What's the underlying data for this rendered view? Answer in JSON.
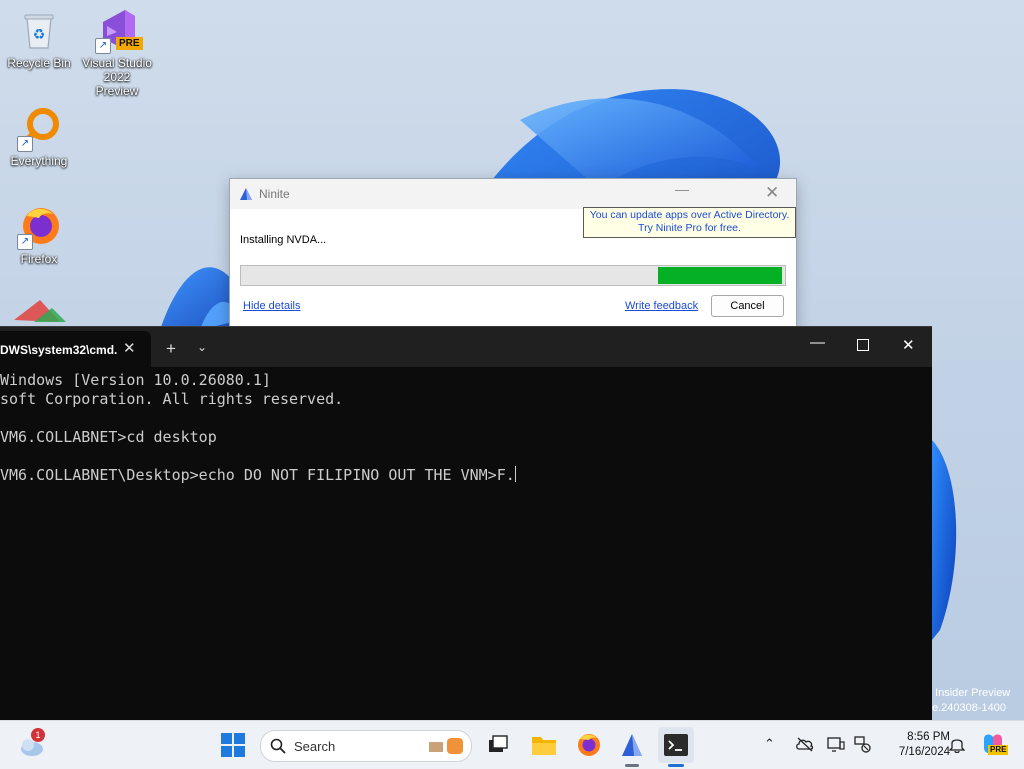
{
  "desktop": {
    "icons": [
      {
        "label": "Recycle Bin"
      },
      {
        "label": "Visual Studio\n2022 Preview",
        "badge": "PRE"
      },
      {
        "label": "Everything"
      },
      {
        "label": "Firefox"
      }
    ],
    "watermark": " Insider Preview\ne.240308-1400"
  },
  "ninite": {
    "title": "Ninite",
    "promo": "You can update apps over Active Directory.\nTry Ninite Pro for free.",
    "status": "Installing NVDA...",
    "progress": 0.23,
    "hide_details": "Hide details",
    "write_feedback": "Write feedback",
    "cancel": "Cancel"
  },
  "terminal": {
    "tab_title": "DWS\\system32\\cmd.",
    "lines": [
      "Windows [Version 10.0.26080.1]",
      "soft Corporation. All rights reserved.",
      "",
      "VM6.COLLABNET>cd desktop",
      "",
      "VM6.COLLABNET\\Desktop>echo DO NOT FILIPINO OUT THE VNM>F."
    ]
  },
  "taskbar": {
    "search_label": "Search",
    "widgets_badge": "1",
    "time": "8:56 PM",
    "date": "7/16/2024",
    "copilot_badge": "PRE"
  },
  "colors": {
    "progress_fill": "#06b025",
    "terminal_bg": "#0c0c0c",
    "link": "#1c4bd6"
  }
}
